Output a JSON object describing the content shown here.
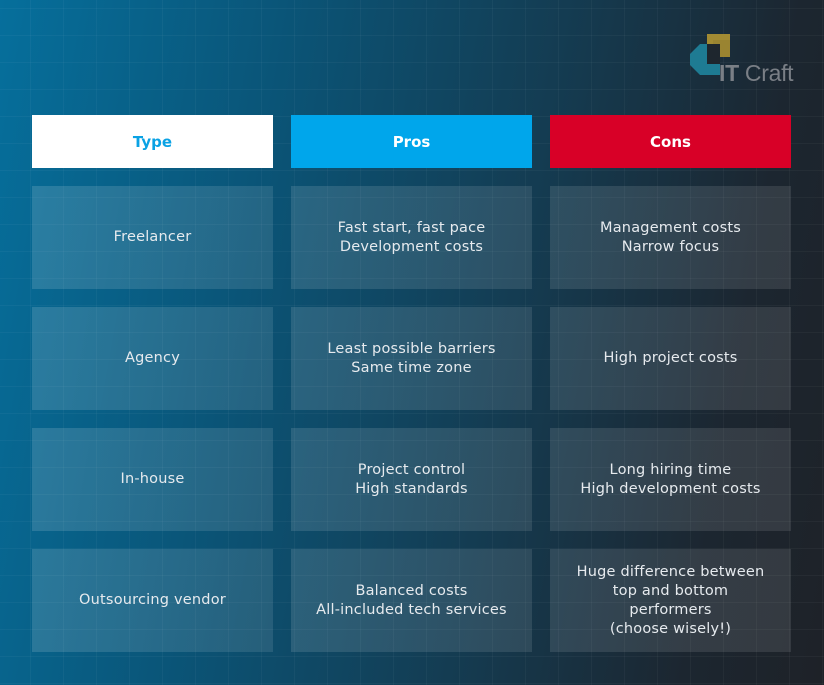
{
  "brand": {
    "name_bold": "IT",
    "name_regular": " Craft",
    "colors": {
      "gold": "#9a8431",
      "teal": "#1e7b93"
    }
  },
  "table": {
    "headers": [
      {
        "label": "Type",
        "color": "#0aa2e4",
        "background": "#ffffff"
      },
      {
        "label": "Pros",
        "color": "#ffffff",
        "background": "#00a6eb"
      },
      {
        "label": "Cons",
        "color": "#ffffff",
        "background": "#d80027"
      }
    ],
    "rows": [
      {
        "type": "Freelancer",
        "pros": "Fast start, fast pace\nDevelopment costs",
        "cons": "Management costs\nNarrow focus"
      },
      {
        "type": "Agency",
        "pros": "Least possible barriers\nSame time zone",
        "cons": "High project costs"
      },
      {
        "type": "In-house",
        "pros": "Project control\nHigh standards",
        "cons": "Long hiring time\nHigh development costs"
      },
      {
        "type": "Outsourcing vendor",
        "pros": "Balanced costs\nAll-included tech services",
        "cons": "Huge difference between\ntop and bottom\nperformers\n(choose wisely!)"
      }
    ]
  }
}
